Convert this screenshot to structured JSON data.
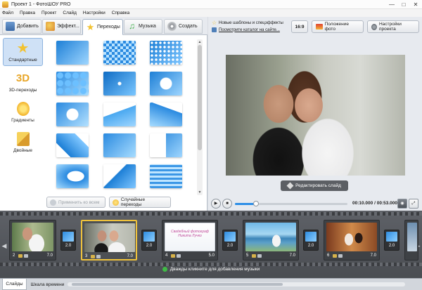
{
  "window": {
    "title": "Проект 1 - ФотоШОУ PRO",
    "controls": [
      "—",
      "□",
      "✕"
    ]
  },
  "menu": [
    "Файл",
    "Правка",
    "Проект",
    "Слайд",
    "Настройки",
    "Справка"
  ],
  "tabs": [
    {
      "label": "Добавить",
      "icon": "folder-icon",
      "color": "#4f7fb8"
    },
    {
      "label": "Эффект...",
      "icon": "palette-icon",
      "color": "#e0a33a"
    },
    {
      "label": "Переходы",
      "icon": "star-icon",
      "color": "#f2c230"
    },
    {
      "label": "Музыка",
      "icon": "music-note-icon",
      "color": "#3fb14a"
    },
    {
      "label": "Создать",
      "icon": "disc-icon",
      "color": "#8c8f94"
    }
  ],
  "active_tab": "Переходы",
  "categories": [
    {
      "label": "Стандартные",
      "icon": "star-icon"
    },
    {
      "label": "3D-переходы",
      "icon": "3d-icon",
      "glyph": "3D"
    },
    {
      "label": "Градиенты",
      "icon": "gradient-icon"
    },
    {
      "label": "Двойные",
      "icon": "double-icon"
    }
  ],
  "active_category": "Стандартные",
  "transitions_count": 15,
  "actions": {
    "apply_all": "Применить ко всем",
    "random": "Случайные переходы"
  },
  "right_top": {
    "new_templates": "Новые шаблоны и спецэффекты",
    "catalog_link": "Посмотрите каталог на сайте...",
    "aspect": "16:9",
    "photo_position": "Положение фото",
    "project_settings": "Настройки проекта"
  },
  "preview": {
    "edit_slide": "Редактировать слайд"
  },
  "player": {
    "time_current": "00:10.000",
    "time_total": "00:53.000",
    "progress": 0.19,
    "separator": "/"
  },
  "timeline": {
    "slides": [
      {
        "num": "2",
        "duration": "7.0"
      },
      {
        "num": "3",
        "duration": "7.0"
      },
      {
        "num": "4",
        "duration": "5.0",
        "caption": "Свадебный фотограф Никита Лучко"
      },
      {
        "num": "5",
        "duration": "7.0"
      },
      {
        "num": "6",
        "duration": "7.0"
      }
    ],
    "transitions": [
      "2.0",
      "2.0",
      "2.0",
      "2.0",
      "2.0"
    ],
    "selected_slide": "3",
    "music_hint": "Дважды кликните для добавления музыки"
  },
  "bottom_tabs": [
    "Слайды",
    "Шкала времени"
  ],
  "colors": {
    "accent": "#2c8ee6",
    "selection": "#f0c33c",
    "panel": "#e7eaef"
  }
}
